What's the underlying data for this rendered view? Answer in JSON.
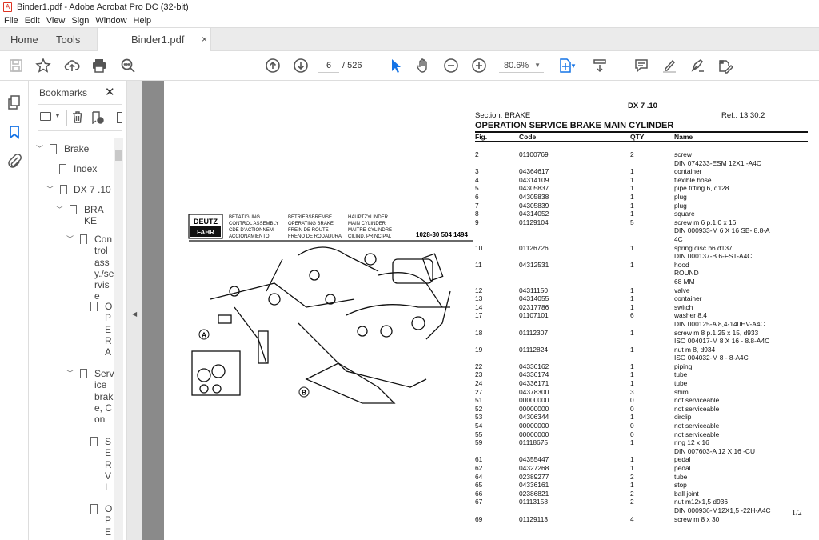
{
  "window": {
    "title": "Binder1.pdf - Adobe Acrobat Pro DC (32-bit)"
  },
  "menu": [
    "File",
    "Edit",
    "View",
    "Sign",
    "Window",
    "Help"
  ],
  "tabs": {
    "home": "Home",
    "tools": "Tools",
    "document": "Binder1.pdf",
    "close": "×"
  },
  "toolbar": {
    "current_page": "6",
    "total_pages": "/ 526",
    "zoom": "80.6%",
    "accent": "#1473e6"
  },
  "bookmarks": {
    "title": "Bookmarks",
    "close": "✕",
    "items": [
      {
        "label": "Brake",
        "expanded": true
      },
      {
        "label": "Index"
      },
      {
        "label": "DX 7 .10",
        "expanded": true
      },
      {
        "label": "BRAKE",
        "expanded": true
      },
      {
        "label": "Control assy./servise",
        "expanded": true
      },
      {
        "label": "OPERA"
      },
      {
        "label": "Service brake, Con",
        "expanded": true
      },
      {
        "label": "SERVI"
      },
      {
        "label": "OPE"
      }
    ]
  },
  "document": {
    "model": "DX 7 .10",
    "section": "Section: BRAKE",
    "ref": "Ref.: 13.30.2",
    "title": "OPERATION SERVICE BRAKE MAIN CYLINDER",
    "columns": [
      "Fig.",
      "Code",
      "QTY",
      "Name"
    ],
    "rows": [
      {
        "fig": "2",
        "code": "01100769",
        "qty": "2",
        "name": [
          "screw",
          "DIN 074233-ESM 12X1 -A4C"
        ]
      },
      {
        "fig": "3",
        "code": "04364617",
        "qty": "1",
        "name": [
          "container"
        ]
      },
      {
        "fig": "4",
        "code": "04314109",
        "qty": "1",
        "name": [
          "flexible hose"
        ]
      },
      {
        "fig": "5",
        "code": "04305837",
        "qty": "1",
        "name": [
          "pipe fitting 6, d128"
        ]
      },
      {
        "fig": "6",
        "code": "04305838",
        "qty": "1",
        "name": [
          "plug"
        ]
      },
      {
        "fig": "7",
        "code": "04305839",
        "qty": "1",
        "name": [
          "plug"
        ]
      },
      {
        "fig": "8",
        "code": "04314052",
        "qty": "1",
        "name": [
          "square"
        ]
      },
      {
        "fig": "9",
        "code": "01129104",
        "qty": "5",
        "name": [
          "screw m 6 p.1.0 x 16",
          "DIN 000933-M 6 X 16 SB- 8.8-A",
          "4C"
        ]
      },
      {
        "fig": "10",
        "code": "01126726",
        "qty": "1",
        "name": [
          "spring disc b6 d137",
          "DIN 000137-B 6-FST-A4C"
        ]
      },
      {
        "fig": "11",
        "code": "04312531",
        "qty": "1",
        "name": [
          "hood",
          "ROUND",
          "68 MM"
        ]
      },
      {
        "fig": "12",
        "code": "04311150",
        "qty": "1",
        "name": [
          "valve"
        ]
      },
      {
        "fig": "13",
        "code": "04314055",
        "qty": "1",
        "name": [
          "container"
        ]
      },
      {
        "fig": "14",
        "code": "02317786",
        "qty": "1",
        "name": [
          "switch"
        ]
      },
      {
        "fig": "17",
        "code": "01107101",
        "qty": "6",
        "name": [
          "washer 8.4",
          "DIN 000125-A 8,4-140HV-A4C"
        ]
      },
      {
        "fig": "18",
        "code": "01112307",
        "qty": "1",
        "name": [
          "screw m 8 p.1.25 x 15, d933",
          "ISO 004017-M 8 X 16 - 8.8-A4C"
        ]
      },
      {
        "fig": "19",
        "code": "01112824",
        "qty": "1",
        "name": [
          "nut m 8, d934",
          "ISO 004032-M 8 - 8-A4C"
        ]
      },
      {
        "fig": "22",
        "code": "04336162",
        "qty": "1",
        "name": [
          "piping"
        ]
      },
      {
        "fig": "23",
        "code": "04336174",
        "qty": "1",
        "name": [
          "tube"
        ]
      },
      {
        "fig": "24",
        "code": "04336171",
        "qty": "1",
        "name": [
          "tube"
        ]
      },
      {
        "fig": "27",
        "code": "04378300",
        "qty": "3",
        "name": [
          "shim"
        ]
      },
      {
        "fig": "51",
        "code": "00000000",
        "qty": "0",
        "name": [
          "not serviceable"
        ]
      },
      {
        "fig": "52",
        "code": "00000000",
        "qty": "0",
        "name": [
          "not serviceable"
        ]
      },
      {
        "fig": "53",
        "code": "04306344",
        "qty": "1",
        "name": [
          "circlip"
        ]
      },
      {
        "fig": "54",
        "code": "00000000",
        "qty": "0",
        "name": [
          "not serviceable"
        ]
      },
      {
        "fig": "55",
        "code": "00000000",
        "qty": "0",
        "name": [
          "not serviceable"
        ]
      },
      {
        "fig": "59",
        "code": "01118675",
        "qty": "1",
        "name": [
          "ring 12 x 16",
          "DIN 007603-A 12 X 16 -CU"
        ]
      },
      {
        "fig": "61",
        "code": "04355447",
        "qty": "1",
        "name": [
          "pedal"
        ]
      },
      {
        "fig": "62",
        "code": "04327268",
        "qty": "1",
        "name": [
          "pedal"
        ]
      },
      {
        "fig": "64",
        "code": "02389277",
        "qty": "2",
        "name": [
          "tube"
        ]
      },
      {
        "fig": "65",
        "code": "04336161",
        "qty": "1",
        "name": [
          "stop"
        ]
      },
      {
        "fig": "66",
        "code": "02386821",
        "qty": "2",
        "name": [
          "ball joint"
        ]
      },
      {
        "fig": "67",
        "code": "01113158",
        "qty": "2",
        "name": [
          "nut m12x1,5 d936",
          "DIN 000936-M12X1,5 -22H-A4C"
        ]
      },
      {
        "fig": "69",
        "code": "01129113",
        "qty": "4",
        "name": [
          "screw m 8 x 30"
        ]
      }
    ],
    "page_number": "1/2",
    "drawing": {
      "logo": "DEUTZ FAHR",
      "col1": [
        "BETÄTIGUNG",
        "CONTROL ASSEMBLY",
        "CDE D'ACTIONNEM.",
        "ACCIONAMIENTO"
      ],
      "col2": [
        "BETRIEBSBREMSE",
        "OPERATING BRAKE",
        "FREIN DE ROUTE",
        "FRENO DE RODADURA"
      ],
      "col3": [
        "HAUPTZYLINDER",
        "MAIN CYLINDER",
        "MAITRE-CYLINDRE",
        "CILIND. PRINCIPAL"
      ],
      "number": "1028-30 504 1494",
      "callouts": [
        "A",
        "B"
      ]
    }
  }
}
